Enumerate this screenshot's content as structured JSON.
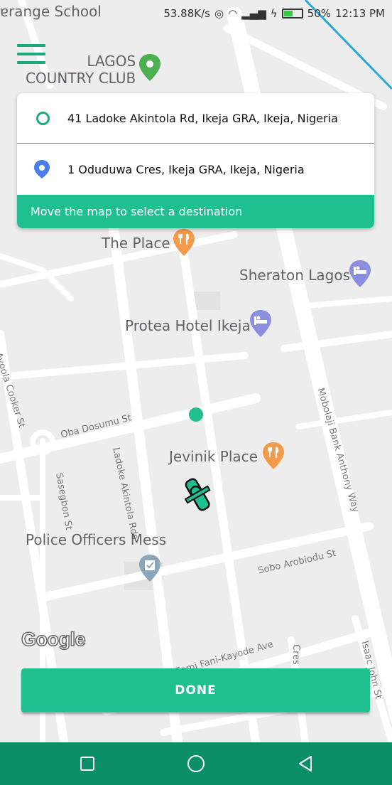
{
  "status_bar": {
    "left_text": "ɐrange School",
    "speed": "53.88K/s",
    "battery": "50%",
    "battery_level": 0.5,
    "time": "12:13 PM"
  },
  "map": {
    "pois": {
      "country_club": "LAGOS\nCOUNTRY CLUB",
      "the_place": "The Place",
      "sheraton": "Sheraton Lagos",
      "protea": "Protea Hotel Ikeja",
      "jevinik": "Jevinik Place",
      "police_mess": "Police Officers Mess"
    },
    "streets": {
      "ayoola": "Ayoola Cooker St",
      "oba_dosumu": "Oba Dosumu St",
      "ladoke": "Ladoke Akintola Rds",
      "sasegbon": "Sasegbon St",
      "mobolaji": "Mobolaji Bank Anthony Way",
      "sobo": "Sobo Arobiodu St",
      "femi": "Femi Fani-Kayode Ave",
      "cres": "Cres",
      "isaac": "Isaac John St"
    },
    "attribution": "Google"
  },
  "route_card": {
    "origin": "41 Ladoke Akintola Rd, Ikeja GRA, Ikeja, Nigeria",
    "destination": "1 Oduduwa Cres, Ikeja GRA, Ikeja, Nigeria",
    "hint": "Move the map to select a destination"
  },
  "done_button": {
    "label": "DONE"
  },
  "colors": {
    "accent": "#1fbf8f",
    "navbar": "#0c8e66",
    "dest_pin": "#4a7ee8"
  },
  "icons": [
    "menu-icon",
    "origin-dot-icon",
    "destination-pin-icon",
    "fork-knife-icon",
    "bed-icon",
    "park-pin-icon",
    "police-icon",
    "rider-icon",
    "square-icon",
    "circle-icon",
    "back-triangle-icon"
  ]
}
